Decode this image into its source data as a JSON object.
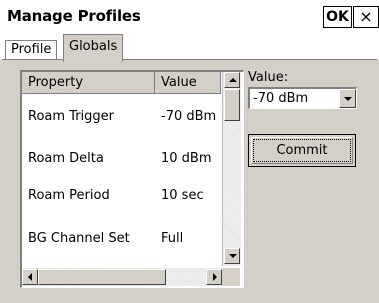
{
  "window": {
    "title": "Manage Profiles",
    "ok_label": "OK",
    "close_label": "×"
  },
  "tabs": [
    {
      "label": "Profile",
      "active": false
    },
    {
      "label": "Globals",
      "active": true
    }
  ],
  "grid": {
    "columns": [
      "Property",
      "Value"
    ],
    "rows": [
      {
        "property": "Roam Trigger",
        "value": "-70 dBm"
      },
      {
        "property": "Roam Delta",
        "value": "10 dBm"
      },
      {
        "property": "Roam Period",
        "value": "10 sec"
      },
      {
        "property": "BG Channel Set",
        "value": "Full"
      }
    ]
  },
  "editor": {
    "value_label": "Value:",
    "selected_value": "-70 dBm",
    "commit_label": "Commit"
  }
}
